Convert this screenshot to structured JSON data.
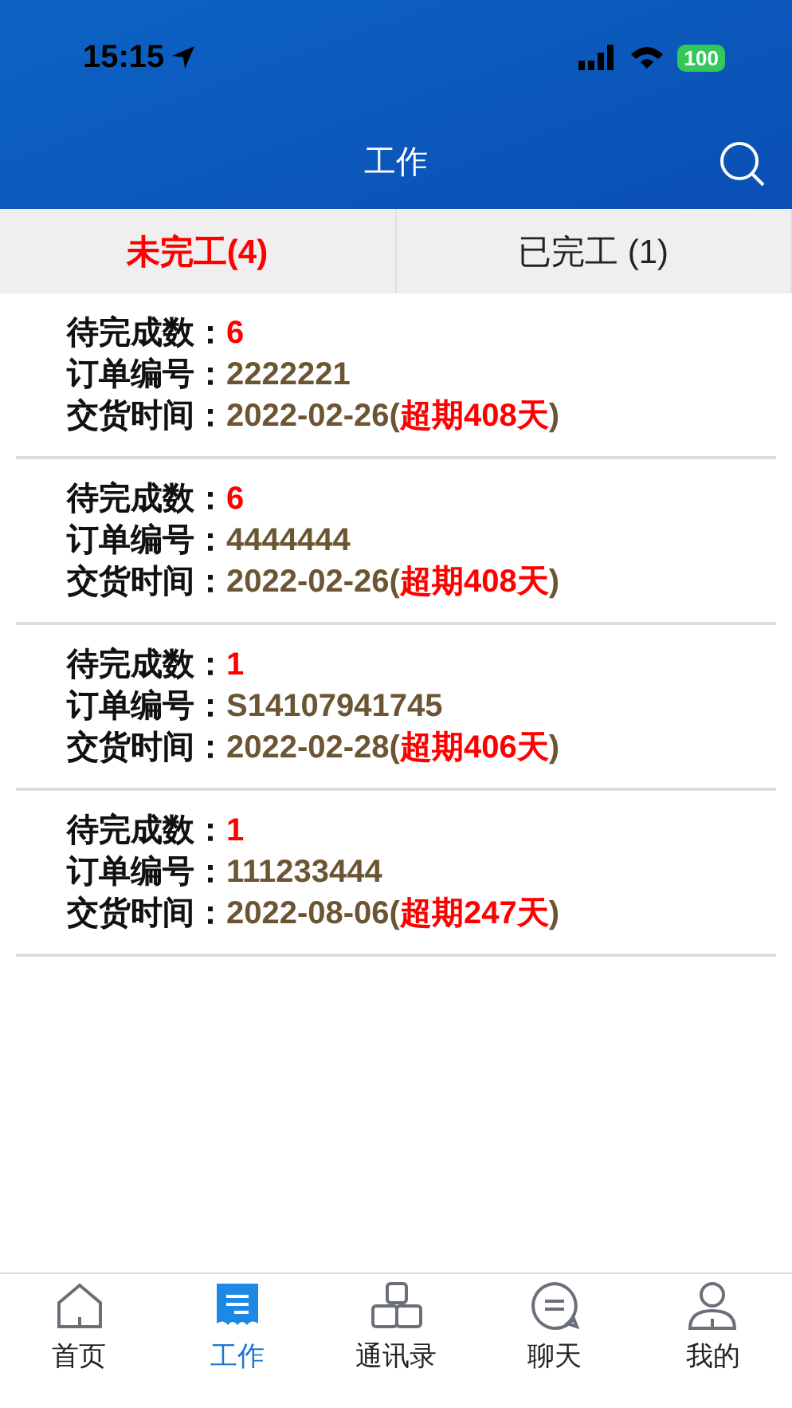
{
  "status_bar": {
    "time": "15:15",
    "battery": "100"
  },
  "header": {
    "title": "工作"
  },
  "tabs": [
    {
      "label": "未完工(4)",
      "selected": true
    },
    {
      "label": "已完工 (1)",
      "selected": false
    }
  ],
  "orders": [
    {
      "lines": [
        {
          "label": "待完成数：",
          "parts": [
            {
              "text": "6",
              "kind": "alert"
            }
          ]
        },
        {
          "label": "订单编号：",
          "parts": [
            {
              "text": "2222221",
              "kind": "plain"
            }
          ]
        },
        {
          "label": "交货时间：",
          "parts": [
            {
              "text": "2022-02-26(",
              "kind": "plain"
            },
            {
              "text": "超期408天",
              "kind": "alert"
            },
            {
              "text": ")",
              "kind": "plain"
            }
          ]
        }
      ]
    },
    {
      "lines": [
        {
          "label": "待完成数：",
          "parts": [
            {
              "text": "6",
              "kind": "alert"
            }
          ]
        },
        {
          "label": "订单编号：",
          "parts": [
            {
              "text": "4444444",
              "kind": "plain"
            }
          ]
        },
        {
          "label": "交货时间：",
          "parts": [
            {
              "text": "2022-02-26(",
              "kind": "plain"
            },
            {
              "text": "超期408天",
              "kind": "alert"
            },
            {
              "text": ")",
              "kind": "plain"
            }
          ]
        }
      ]
    },
    {
      "lines": [
        {
          "label": "待完成数：",
          "parts": [
            {
              "text": "1",
              "kind": "alert"
            }
          ]
        },
        {
          "label": "订单编号：",
          "parts": [
            {
              "text": "S14107941745",
              "kind": "plain"
            }
          ]
        },
        {
          "label": "交货时间：",
          "parts": [
            {
              "text": "2022-02-28(",
              "kind": "plain"
            },
            {
              "text": "超期406天",
              "kind": "alert"
            },
            {
              "text": ")",
              "kind": "plain"
            }
          ]
        }
      ]
    },
    {
      "lines": [
        {
          "label": "待完成数：",
          "parts": [
            {
              "text": "1",
              "kind": "alert"
            }
          ]
        },
        {
          "label": "订单编号：",
          "parts": [
            {
              "text": "111233444",
              "kind": "plain"
            }
          ]
        },
        {
          "label": "交货时间：",
          "parts": [
            {
              "text": "2022-08-06(",
              "kind": "plain"
            },
            {
              "text": "超期247天",
              "kind": "alert"
            },
            {
              "text": ")",
              "kind": "plain"
            }
          ]
        }
      ]
    }
  ],
  "nav": [
    {
      "label": "首页",
      "kind": "home",
      "selected": false
    },
    {
      "label": "工作",
      "kind": "work",
      "selected": true
    },
    {
      "label": "通讯录",
      "kind": "contacts",
      "selected": false
    },
    {
      "label": "聊天",
      "kind": "chat",
      "selected": false
    },
    {
      "label": "我的",
      "kind": "me",
      "selected": false
    }
  ]
}
